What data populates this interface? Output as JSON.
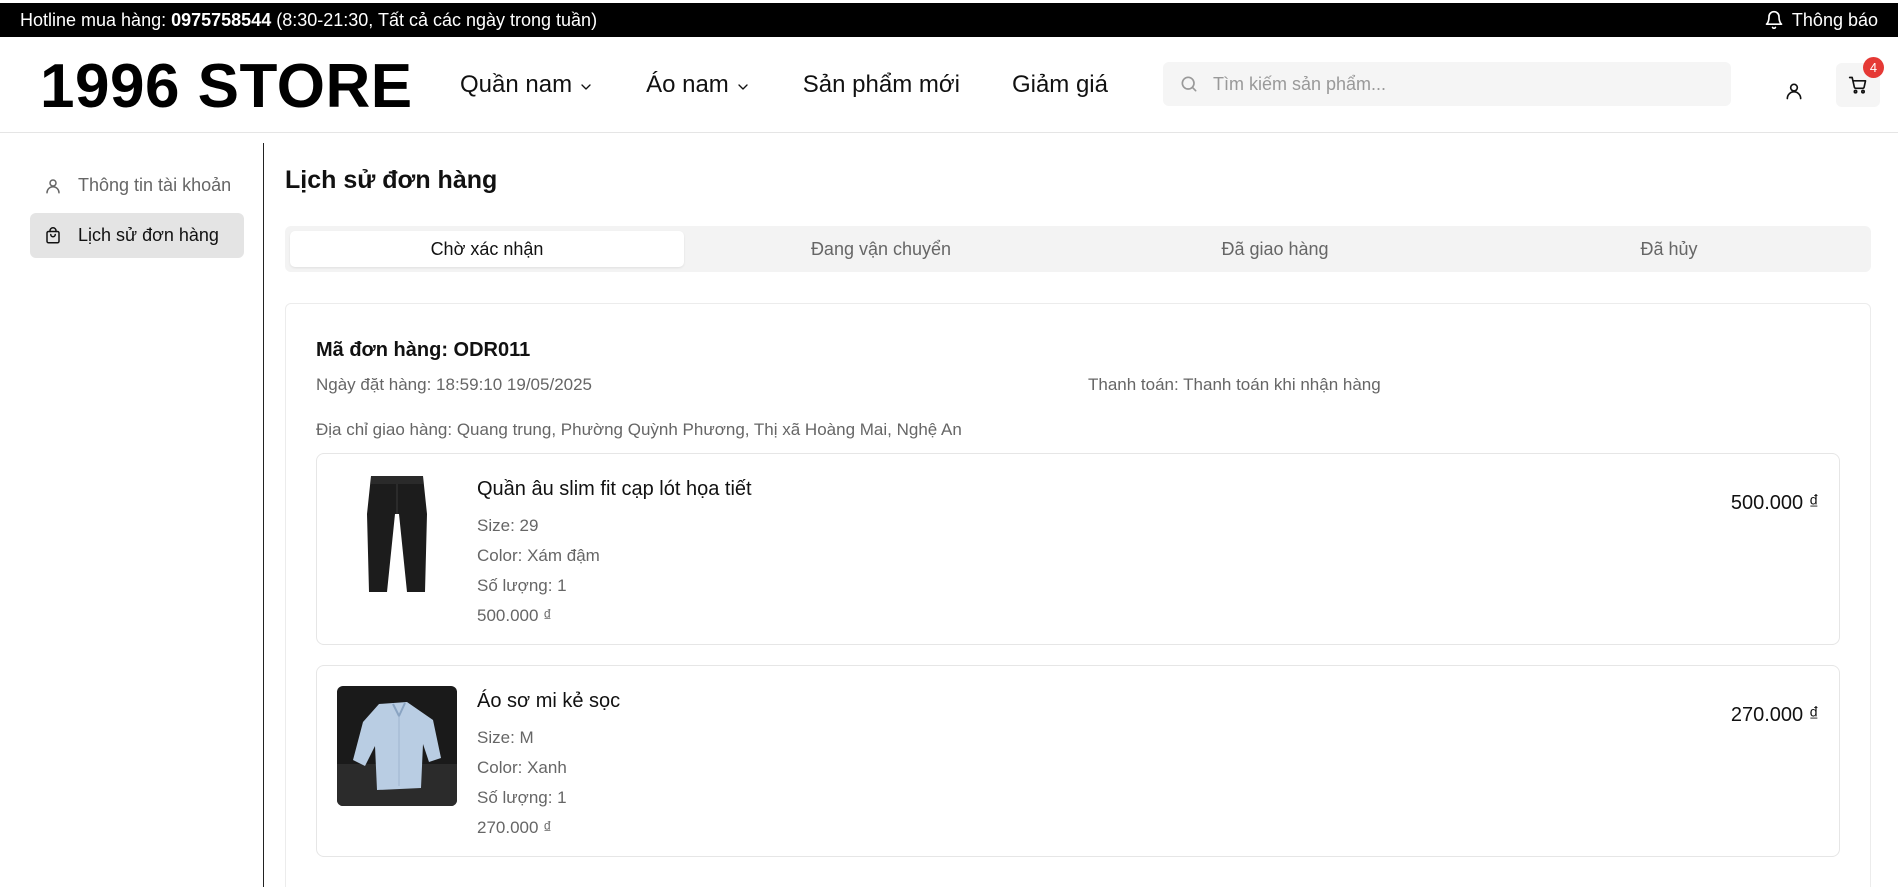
{
  "topbar": {
    "hotline_label": "Hotline mua hàng: ",
    "hotline_number": "0975758544",
    "hotline_hours": " (8:30-21:30, Tất cả các ngày trong tuần)",
    "notice_label": "Thông báo"
  },
  "header": {
    "logo": "1996 STORE",
    "nav": [
      {
        "label": "Quần nam",
        "has_dropdown": true
      },
      {
        "label": "Áo nam",
        "has_dropdown": true
      },
      {
        "label": "Sản phẩm mới",
        "has_dropdown": false
      },
      {
        "label": "Giảm giá",
        "has_dropdown": false
      }
    ],
    "search_placeholder": "Tìm kiếm sản phẩm...",
    "cart_count": "4"
  },
  "sidebar": {
    "items": [
      {
        "label": "Thông tin tài khoản",
        "icon": "user-icon",
        "active": false
      },
      {
        "label": "Lịch sử đơn hàng",
        "icon": "shopping-bag-icon",
        "active": true
      }
    ]
  },
  "main": {
    "title": "Lịch sử đơn hàng",
    "tabs": [
      {
        "label": "Chờ xác nhận",
        "active": true
      },
      {
        "label": "Đang vận chuyển",
        "active": false
      },
      {
        "label": "Đã giao hàng",
        "active": false
      },
      {
        "label": "Đã hủy",
        "active": false
      }
    ],
    "order": {
      "id_label": "Mã đơn hàng: ODR011",
      "date_label": "Ngày đặt hàng: 18:59:10 19/05/2025",
      "payment_label": "Thanh toán: Thanh toán khi nhận hàng",
      "address_label": "Địa chỉ giao hàng: Quang trung, Phường Quỳnh Phương, Thị xã Hoàng Mai, Nghệ An",
      "items": [
        {
          "name": "Quần âu slim fit cạp lót họa tiết",
          "size": "Size: 29",
          "color": "Color: Xám đậm",
          "quantity": "Số lượng: 1",
          "unit_price": "500.000 ₫",
          "total_price": "500.000 ₫"
        },
        {
          "name": "Áo sơ mi kẻ sọc",
          "size": "Size: M",
          "color": "Color: Xanh",
          "quantity": "Số lượng: 1",
          "unit_price": "270.000 ₫",
          "total_price": "270.000 ₫"
        }
      ]
    }
  },
  "colors": {
    "topbar_bg": "#000000",
    "badge": "#e53935",
    "active_sidebar_bg": "#e4e4e4",
    "tabs_bg": "#f3f3f3"
  }
}
